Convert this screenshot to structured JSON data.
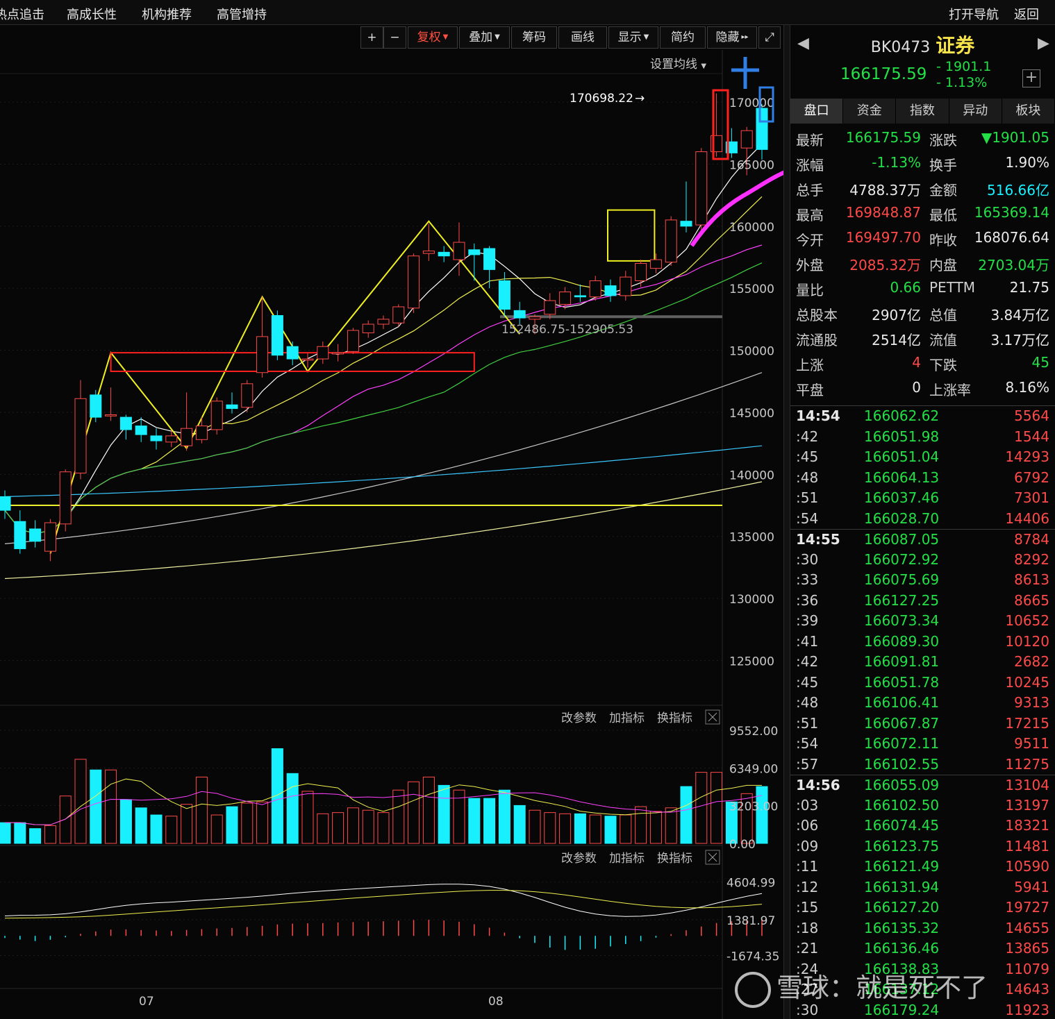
{
  "top_nav": {
    "items": [
      "热点追击",
      "高成长性",
      "机构推荐",
      "高管增持"
    ],
    "nav_button": "打开导航",
    "back_button": "返回"
  },
  "toolbar": {
    "plus": "+",
    "minus": "−",
    "fuquan": "复权",
    "overlay": "叠加",
    "chips": "筹码",
    "draw": "画线",
    "display": "显示",
    "simple": "简约",
    "hide": "隐藏",
    "fullscreen_icon": "expand-icon"
  },
  "main_chart": {
    "ma_setting": "设置均线",
    "high_marker": "170698.22",
    "range_label": "152486.75-152905.53"
  },
  "volume_panel": {
    "ctrl_params": "改参数",
    "ctrl_add": "加指标",
    "ctrl_switch": "换指标"
  },
  "macd_panel": {
    "ctrl_params": "改参数",
    "ctrl_add": "加指标",
    "ctrl_switch": "换指标"
  },
  "chart_data": {
    "type": "candlestick",
    "x_labels": [
      "07",
      "08"
    ],
    "price_axis": [
      "170000",
      "165000",
      "160000",
      "155000",
      "150000",
      "145000",
      "140000",
      "135000",
      "130000",
      "125000"
    ],
    "price_range": [
      121500,
      174200
    ],
    "volume_axis": [
      "9552.00",
      "6349.00",
      "3203.00",
      "0.00"
    ],
    "volume_range": [
      0,
      9552
    ],
    "macd_axis": [
      "4604.99",
      "1381.97",
      "-1674.35"
    ],
    "macd_range": [
      -4500,
      5600
    ],
    "candles": [
      {
        "o": 138200,
        "h": 138700,
        "c": 137100,
        "l": 136400
      },
      {
        "o": 136200,
        "h": 137100,
        "c": 134000,
        "l": 133600
      },
      {
        "o": 135600,
        "h": 136300,
        "c": 134600,
        "l": 134100
      },
      {
        "o": 133800,
        "h": 136400,
        "c": 136100,
        "l": 133000
      },
      {
        "o": 136000,
        "h": 140400,
        "c": 140200,
        "l": 135400
      },
      {
        "o": 140100,
        "h": 147600,
        "c": 146100,
        "l": 139600
      },
      {
        "o": 146400,
        "h": 146800,
        "c": 144600,
        "l": 144200
      },
      {
        "o": 144700,
        "h": 147000,
        "c": 144800,
        "l": 144300
      },
      {
        "o": 144600,
        "h": 144800,
        "c": 143600,
        "l": 142800
      },
      {
        "o": 143900,
        "h": 144600,
        "c": 143200,
        "l": 142600
      },
      {
        "o": 143100,
        "h": 143700,
        "c": 142700,
        "l": 142000
      },
      {
        "o": 142600,
        "h": 143500,
        "c": 143100,
        "l": 142200
      },
      {
        "o": 142300,
        "h": 146600,
        "c": 143700,
        "l": 141900
      },
      {
        "o": 142800,
        "h": 144600,
        "c": 143900,
        "l": 142500
      },
      {
        "o": 143600,
        "h": 146200,
        "c": 145900,
        "l": 143200
      },
      {
        "o": 145600,
        "h": 146600,
        "c": 145300,
        "l": 144900
      },
      {
        "o": 145400,
        "h": 147600,
        "c": 147300,
        "l": 145000
      },
      {
        "o": 148200,
        "h": 154300,
        "c": 151100,
        "l": 147800
      },
      {
        "o": 152800,
        "h": 153200,
        "c": 149600,
        "l": 149200
      },
      {
        "o": 150300,
        "h": 150700,
        "c": 149300,
        "l": 148800
      },
      {
        "o": 149200,
        "h": 149800,
        "c": 149300,
        "l": 148600
      },
      {
        "o": 149300,
        "h": 150700,
        "c": 150300,
        "l": 148900
      },
      {
        "o": 149700,
        "h": 150500,
        "c": 149800,
        "l": 149100
      },
      {
        "o": 149900,
        "h": 151800,
        "c": 151600,
        "l": 149700
      },
      {
        "o": 151400,
        "h": 152400,
        "c": 152100,
        "l": 151000
      },
      {
        "o": 152100,
        "h": 152800,
        "c": 152500,
        "l": 151700
      },
      {
        "o": 152200,
        "h": 153700,
        "c": 153500,
        "l": 151900
      },
      {
        "o": 153400,
        "h": 157800,
        "c": 157600,
        "l": 153000
      },
      {
        "o": 157800,
        "h": 160200,
        "c": 158000,
        "l": 157200
      },
      {
        "o": 157900,
        "h": 158400,
        "c": 157600,
        "l": 157100
      },
      {
        "o": 157300,
        "h": 160300,
        "c": 158700,
        "l": 156000
      },
      {
        "o": 158100,
        "h": 158600,
        "c": 157700,
        "l": 155600
      },
      {
        "o": 158200,
        "h": 158400,
        "c": 156500,
        "l": 155000
      },
      {
        "o": 155600,
        "h": 156300,
        "c": 153300,
        "l": 152700
      },
      {
        "o": 153200,
        "h": 153900,
        "c": 152600,
        "l": 152100
      },
      {
        "o": 152500,
        "h": 152900,
        "c": 152700,
        "l": 151300
      },
      {
        "o": 152900,
        "h": 154600,
        "c": 154000,
        "l": 152500
      },
      {
        "o": 153700,
        "h": 155100,
        "c": 154700,
        "l": 153300
      },
      {
        "o": 154400,
        "h": 155300,
        "c": 154300,
        "l": 153900
      },
      {
        "o": 154300,
        "h": 156000,
        "c": 155600,
        "l": 154000
      },
      {
        "o": 155200,
        "h": 155700,
        "c": 154400,
        "l": 153900
      },
      {
        "o": 154400,
        "h": 156400,
        "c": 155900,
        "l": 154000
      },
      {
        "o": 155600,
        "h": 157300,
        "c": 157000,
        "l": 155100
      },
      {
        "o": 156600,
        "h": 157800,
        "c": 157300,
        "l": 156200
      },
      {
        "o": 157100,
        "h": 160800,
        "c": 160500,
        "l": 156800
      },
      {
        "o": 160400,
        "h": 163600,
        "c": 160000,
        "l": 159500
      },
      {
        "o": 160100,
        "h": 166300,
        "c": 166000,
        "l": 159700
      },
      {
        "o": 166000,
        "h": 170700,
        "c": 167300,
        "l": 165600
      },
      {
        "o": 166800,
        "h": 167900,
        "c": 165900,
        "l": 165500
      },
      {
        "o": 166300,
        "h": 168000,
        "c": 167700,
        "l": 164100
      },
      {
        "o": 169500,
        "h": 169850,
        "c": 166180,
        "l": 165370
      }
    ],
    "volumes": [
      1750,
      1750,
      1250,
      1500,
      4000,
      7100,
      6200,
      6200,
      3700,
      3000,
      2400,
      2300,
      3300,
      5600,
      2400,
      3100,
      3400,
      3500,
      8000,
      5900,
      4400,
      2500,
      2600,
      3000,
      2800,
      2600,
      4500,
      5200,
      5600,
      4900,
      4500,
      3800,
      3800,
      4500,
      3200,
      2800,
      2600,
      2500,
      2500,
      2400,
      2300,
      2400,
      3100,
      2700,
      3000,
      4800,
      6000,
      6000,
      3500,
      4200,
      4800
    ],
    "macd_hist": [
      -180,
      -320,
      -440,
      -330,
      -120,
      180,
      380,
      540,
      560,
      500,
      460,
      420,
      510,
      580,
      640,
      680,
      760,
      860,
      980,
      1050,
      1080,
      1100,
      1150,
      1180,
      1220,
      1250,
      1300,
      1360,
      1380,
      1320,
      1210,
      1000,
      700,
      280,
      -200,
      -600,
      -1000,
      -1200,
      -1180,
      -1100,
      -900,
      -700,
      -450,
      -150,
      150,
      480,
      800,
      1100,
      1250,
      1350,
      1400
    ],
    "annotation_boxes": [
      "red-box",
      "yellow-box",
      "blue-box",
      "blue-box"
    ]
  },
  "quote_panel": {
    "code": "BK0473",
    "name": "证券",
    "last_price": "166175.59",
    "change": "- 1901.1",
    "change_pct": "- 1.13%",
    "add_icon": "plus-square-icon",
    "tabs": [
      "盘口",
      "资金",
      "指数",
      "异动",
      "板块"
    ],
    "rows": [
      {
        "l1": "最新",
        "v1": "166175.59",
        "c1": "green",
        "l2": "涨跌",
        "v2": "▼1901.05",
        "c2": "green"
      },
      {
        "l1": "涨幅",
        "v1": "-1.13%",
        "c1": "green",
        "l2": "换手",
        "v2": "1.90%",
        "c2": "white"
      },
      {
        "l1": "总手",
        "v1": "4788.37万",
        "c1": "white",
        "l2": "金额",
        "v2": "516.66亿",
        "c2": "cyan"
      },
      {
        "l1": "最高",
        "v1": "169848.87",
        "c1": "red",
        "l2": "最低",
        "v2": "165369.14",
        "c2": "green"
      },
      {
        "l1": "今开",
        "v1": "169497.70",
        "c1": "red",
        "l2": "昨收",
        "v2": "168076.64",
        "c2": "white"
      },
      {
        "l1": "外盘",
        "v1": "2085.32万",
        "c1": "red",
        "l2": "内盘",
        "v2": "2703.04万",
        "c2": "green"
      },
      {
        "l1": "量比",
        "v1": "0.66",
        "c1": "green",
        "l2": "PETTM",
        "v2": "21.75",
        "c2": "white"
      },
      {
        "l1": "总股本",
        "v1": "2907亿",
        "c1": "white",
        "l2": "总值",
        "v2": "3.84万亿",
        "c2": "white"
      },
      {
        "l1": "流通股",
        "v1": "2514亿",
        "c1": "white",
        "l2": "流值",
        "v2": "3.17万亿",
        "c2": "white"
      },
      {
        "l1": "上涨",
        "v1": "4",
        "c1": "red",
        "l2": "下跌",
        "v2": "45",
        "c2": "green"
      },
      {
        "l1": "平盘",
        "v1": "0",
        "c1": "white",
        "l2": "上涨率",
        "v2": "8.16%",
        "c2": "white"
      }
    ],
    "ticks": [
      {
        "t": "14:54",
        "p": "166062.62",
        "v": "5564",
        "major": true
      },
      {
        "t": ":42",
        "p": "166051.98",
        "v": "1544"
      },
      {
        "t": ":45",
        "p": "166051.04",
        "v": "14293"
      },
      {
        "t": ":48",
        "p": "166064.13",
        "v": "6792"
      },
      {
        "t": ":51",
        "p": "166037.46",
        "v": "7301"
      },
      {
        "t": ":54",
        "p": "166028.70",
        "v": "14406"
      },
      {
        "t": "14:55",
        "p": "166087.05",
        "v": "8784",
        "major": true
      },
      {
        "t": ":30",
        "p": "166072.92",
        "v": "8292"
      },
      {
        "t": ":33",
        "p": "166075.69",
        "v": "8613"
      },
      {
        "t": ":36",
        "p": "166127.25",
        "v": "8665"
      },
      {
        "t": ":39",
        "p": "166073.34",
        "v": "10652"
      },
      {
        "t": ":41",
        "p": "166089.30",
        "v": "10120"
      },
      {
        "t": ":42",
        "p": "166091.81",
        "v": "2682"
      },
      {
        "t": ":45",
        "p": "166051.78",
        "v": "10245"
      },
      {
        "t": ":48",
        "p": "166106.41",
        "v": "9313"
      },
      {
        "t": ":51",
        "p": "166067.87",
        "v": "17215"
      },
      {
        "t": ":54",
        "p": "166072.11",
        "v": "9511"
      },
      {
        "t": ":57",
        "p": "166102.55",
        "v": "11275"
      },
      {
        "t": "14:56",
        "p": "166055.09",
        "v": "13104",
        "major": true
      },
      {
        "t": ":03",
        "p": "166102.50",
        "v": "13197"
      },
      {
        "t": ":06",
        "p": "166074.45",
        "v": "18321"
      },
      {
        "t": ":09",
        "p": "166123.75",
        "v": "11481"
      },
      {
        "t": ":11",
        "p": "166121.49",
        "v": "10590"
      },
      {
        "t": ":12",
        "p": "166131.94",
        "v": "5941"
      },
      {
        "t": ":15",
        "p": "166127.20",
        "v": "19727"
      },
      {
        "t": ":18",
        "p": "166135.32",
        "v": "14655"
      },
      {
        "t": ":21",
        "p": "166136.46",
        "v": "13865"
      },
      {
        "t": ":24",
        "p": "166138.83",
        "v": "11079"
      },
      {
        "t": ":27",
        "p": "166137.12",
        "v": "14643"
      },
      {
        "t": ":30",
        "p": "166179.24",
        "v": "11923"
      }
    ]
  },
  "watermark": {
    "text": "雪球：就是死不了"
  },
  "colors": {
    "up": "#ff4a4a",
    "down": "#18f0ff",
    "ma5": "#ffffff",
    "ma10": "#f0f050",
    "ma20": "#ff40ff",
    "ma30": "#40d040",
    "ma60": "#c8c8c8",
    "ma120": "#3ac8ff",
    "ma250": "#f0f0a0"
  }
}
